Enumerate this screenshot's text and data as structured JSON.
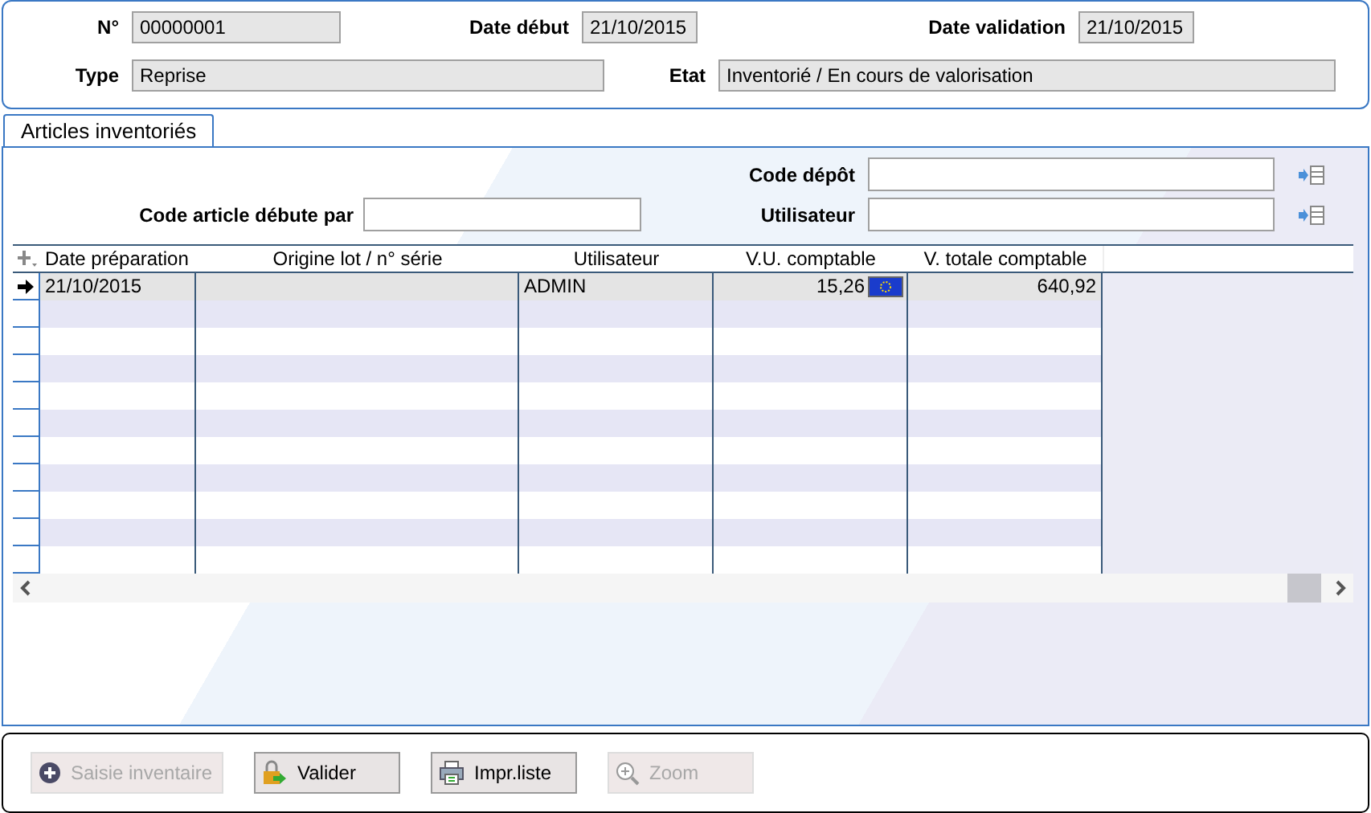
{
  "header": {
    "fields": [
      {
        "label": "N°",
        "value": "00000001"
      },
      {
        "label": "Date début",
        "value": "21/10/2015"
      },
      {
        "label": "Date validation",
        "value": "21/10/2015"
      },
      {
        "label": "Type",
        "value": "Reprise"
      },
      {
        "label": "Etat",
        "value": "Inventorié / En cours de valorisation"
      }
    ]
  },
  "tabs": [
    {
      "label": "Articles inventoriés",
      "selected": true
    }
  ],
  "filters": [
    {
      "label": "Code dépôt"
    },
    {
      "label": "Code article débute par"
    },
    {
      "label": "Utilisateur"
    }
  ],
  "table": {
    "columns": [
      "Date préparation",
      "Origine lot / n° série",
      "Utilisateur",
      "V.U. comptable",
      "V. totale comptable"
    ],
    "rows": [
      {
        "cells": [
          "21/10/2015",
          "",
          "ADMIN",
          "15,26",
          "640,92"
        ],
        "selected": true
      }
    ]
  },
  "buttons": [
    {
      "label": "Saisie inventaire",
      "disabled": true,
      "kind": "add"
    },
    {
      "label": "Valider",
      "disabled": false,
      "kind": "validate"
    },
    {
      "label": "Impr.liste",
      "disabled": false,
      "kind": "print"
    },
    {
      "label": "Zoom",
      "disabled": true,
      "kind": "zoom"
    }
  ]
}
